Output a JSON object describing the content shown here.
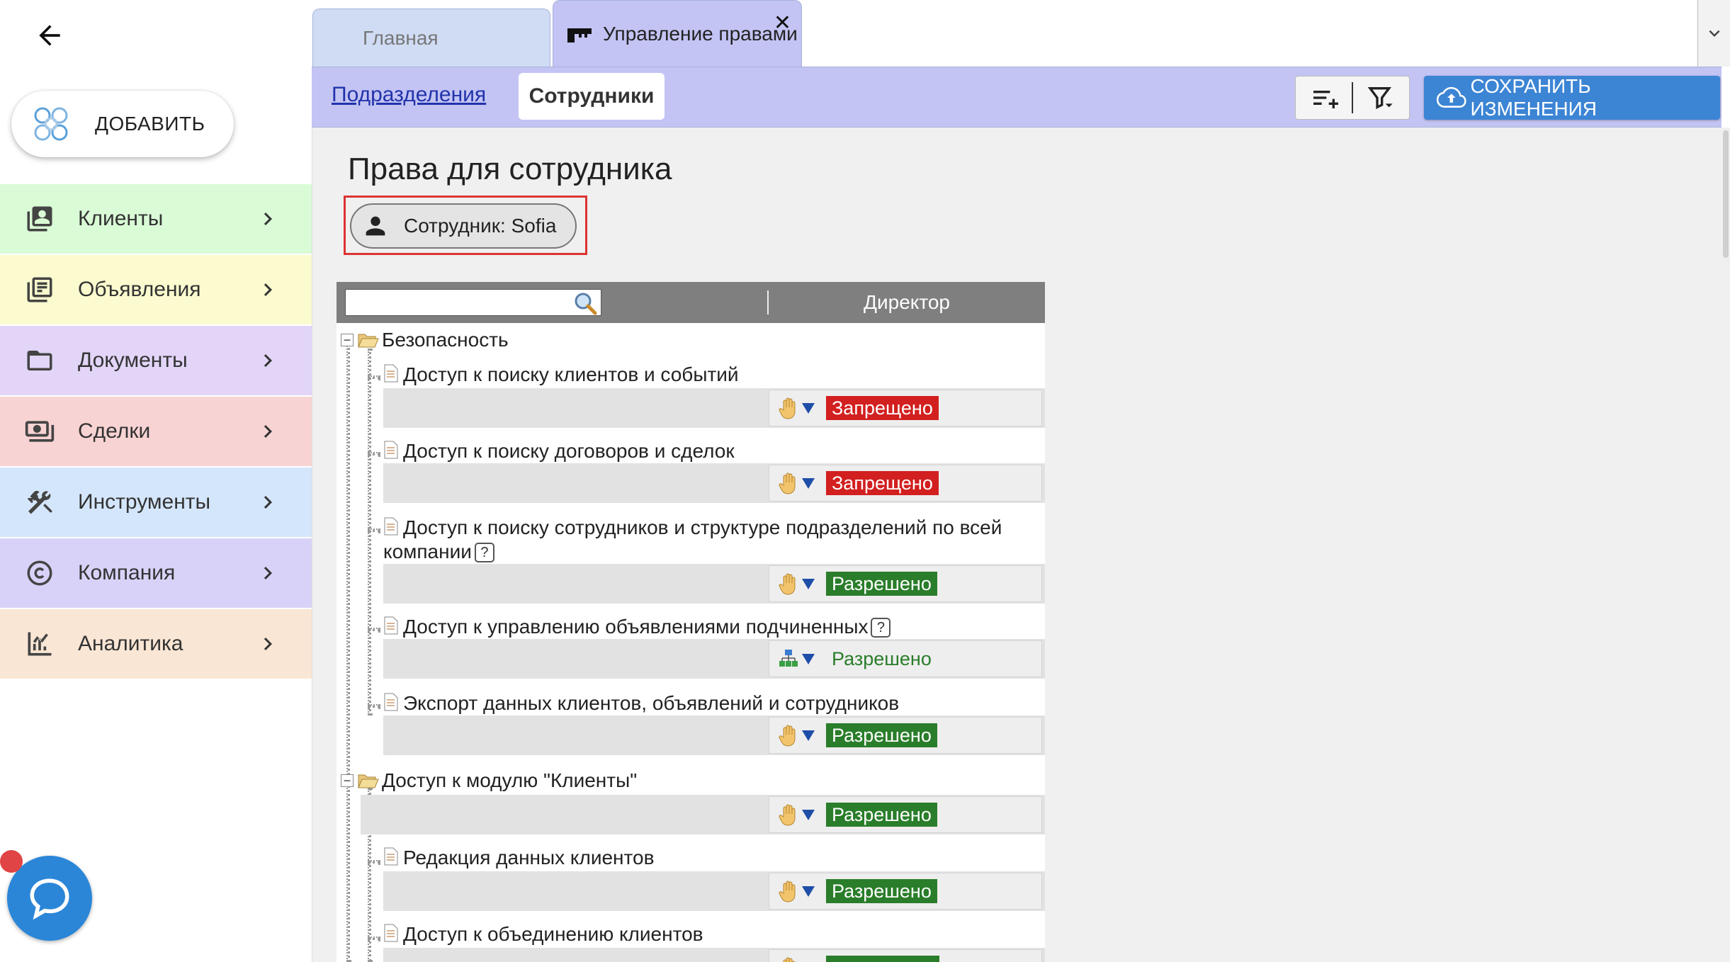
{
  "sidebar": {
    "add_label": "ДОБАВИТЬ",
    "items": [
      {
        "label": "Клиенты",
        "color": "#d9fbd6",
        "icon": "contacts-icon"
      },
      {
        "label": "Объявления",
        "color": "#fbfbcf",
        "icon": "listings-icon"
      },
      {
        "label": "Документы",
        "color": "#e2d5f8",
        "icon": "folder-icon"
      },
      {
        "label": "Сделки",
        "color": "#f8d3d3",
        "icon": "money-icon"
      },
      {
        "label": "Инструменты",
        "color": "#d4e6fb",
        "icon": "tools-icon"
      },
      {
        "label": "Компания",
        "color": "#d9d2f8",
        "icon": "copyright-icon"
      },
      {
        "label": "Аналитика",
        "color": "#fae6d4",
        "icon": "analytics-icon"
      }
    ]
  },
  "tabs": {
    "home_label": "Главная",
    "rights_label": "Управление правами",
    "close_label": "✕"
  },
  "toolbar": {
    "divisions_label": "Подразделения",
    "employees_label": "Сотрудники",
    "save_label": "СОХРАНИТЬ ИЗМЕНЕНИЯ"
  },
  "main": {
    "title": "Права для сотрудника",
    "employee_chip": "Сотрудник: Sofia",
    "column_title": "Директор",
    "search_value": "",
    "groups": [
      {
        "label": "Безопасность"
      },
      {
        "label": "Доступ к модулю \"Клиенты\"",
        "value": "Разрешено"
      }
    ],
    "items": [
      {
        "title": "Доступ к поиску клиентов и событий",
        "value": "Запрещено",
        "state": "deny",
        "source": "manual"
      },
      {
        "title": "Доступ к поиску договоров и сделок",
        "value": "Запрещено",
        "state": "deny",
        "source": "manual"
      },
      {
        "title": "Доступ к поиску сотрудников и структуре подразделений по всей",
        "title2": "компании",
        "value": "Разрешено",
        "state": "allow",
        "source": "manual",
        "help": "?"
      },
      {
        "title": "Доступ к управлению объявлениями подчиненных",
        "value": "Разрешено",
        "state": "inherit",
        "source": "structure",
        "help": "?"
      },
      {
        "title": "Экспорт данных клиентов, объявлений и сотрудников",
        "value": "Разрешено",
        "state": "allow",
        "source": "manual"
      },
      {
        "title": "Редакция данных клиентов",
        "value": "Разрешено",
        "state": "allow",
        "source": "manual"
      },
      {
        "title": "Доступ к объединению клиентов",
        "value": "",
        "state": "allow",
        "source": "manual"
      }
    ]
  },
  "colors": {
    "accent": "#3c84d4",
    "tab_active": "#c3c4f4",
    "deny": "#d21f1f",
    "allow": "#2a7d2a"
  }
}
